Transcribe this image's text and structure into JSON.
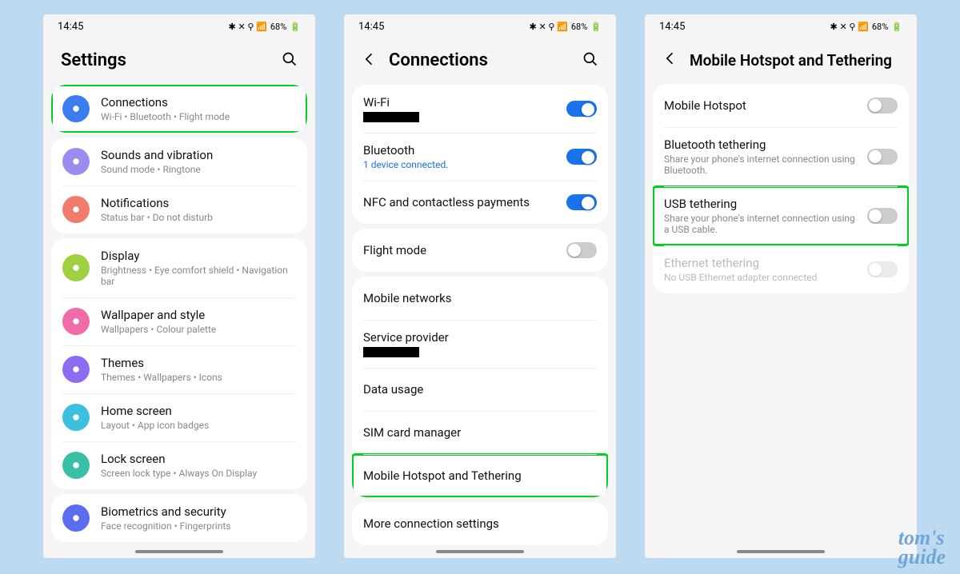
{
  "status": {
    "time": "14:45",
    "battery": "68%"
  },
  "watermark": {
    "line1": "tom's",
    "line2": "guide"
  },
  "phone1": {
    "title": "Settings",
    "items": [
      {
        "title": "Connections",
        "sub": "Wi-Fi  •  Bluetooth  •  Flight mode",
        "color": "#3b7cf0",
        "highlight": true
      },
      {
        "title": "Sounds and vibration",
        "sub": "Sound mode  •  Ringtone",
        "color": "#9b8cf0"
      },
      {
        "title": "Notifications",
        "sub": "Status bar  •  Do not disturb",
        "color": "#f07c6c"
      },
      {
        "title": "Display",
        "sub": "Brightness  •  Eye comfort shield  •  Navigation bar",
        "color": "#9ed040"
      },
      {
        "title": "Wallpaper and style",
        "sub": "Wallpapers  •  Colour palette",
        "color": "#f06ca8"
      },
      {
        "title": "Themes",
        "sub": "Themes  •  Wallpapers  •  Icons",
        "color": "#8c6cf0"
      },
      {
        "title": "Home screen",
        "sub": "Layout  •  App icon badges",
        "color": "#3bc0e0"
      },
      {
        "title": "Lock screen",
        "sub": "Screen lock type  •  Always On Display",
        "color": "#3bc0a8"
      },
      {
        "title": "Biometrics and security",
        "sub": "Face recognition  •  Fingerprints",
        "color": "#5c6cf0"
      }
    ]
  },
  "phone2": {
    "title": "Connections",
    "groups": [
      [
        {
          "title": "Wi-Fi",
          "redacted": true,
          "toggle": "on"
        },
        {
          "title": "Bluetooth",
          "sub": "1 device connected.",
          "sub_blue": true,
          "toggle": "on"
        },
        {
          "title": "NFC and contactless payments",
          "toggle": "on"
        }
      ],
      [
        {
          "title": "Flight mode",
          "toggle": "off"
        }
      ],
      [
        {
          "title": "Mobile networks"
        },
        {
          "title": "Service provider",
          "redacted": true
        },
        {
          "title": "Data usage"
        },
        {
          "title": "SIM card manager"
        },
        {
          "title": "Mobile Hotspot and Tethering",
          "highlight": true
        }
      ],
      [
        {
          "title": "More connection settings"
        }
      ]
    ]
  },
  "phone3": {
    "title": "Mobile Hotspot and Tethering",
    "items": [
      {
        "title": "Mobile Hotspot",
        "toggle": "off"
      },
      {
        "title": "Bluetooth tethering",
        "sub": "Share your phone's internet connection using Bluetooth.",
        "toggle": "off"
      },
      {
        "title": "USB tethering",
        "sub": "Share your phone's internet connection using a USB cable.",
        "toggle": "off",
        "highlight": true
      },
      {
        "title": "Ethernet tethering",
        "sub": "No USB Ethernet adapter connected",
        "toggle": "off",
        "dim": true
      }
    ]
  }
}
